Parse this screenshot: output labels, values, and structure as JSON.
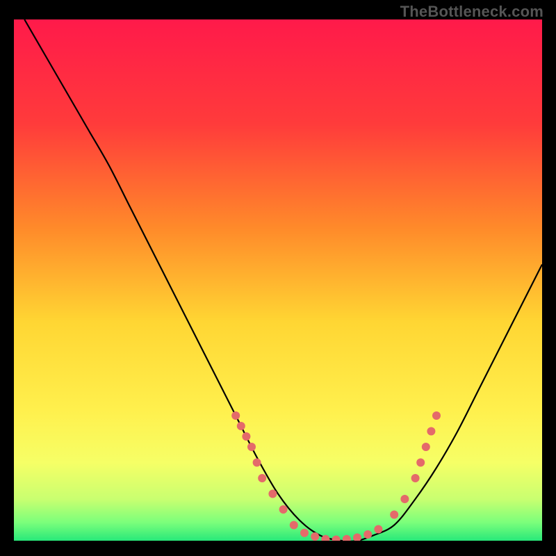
{
  "watermark": "TheBottleneck.com",
  "chart_data": {
    "type": "line",
    "title": "",
    "xlabel": "",
    "ylabel": "",
    "xlim": [
      0,
      100
    ],
    "ylim": [
      0,
      100
    ],
    "background_gradient": {
      "orientation": "vertical",
      "stops": [
        {
          "offset": 0.0,
          "color": "#ff1a4a"
        },
        {
          "offset": 0.2,
          "color": "#ff3b3b"
        },
        {
          "offset": 0.4,
          "color": "#ff8a2a"
        },
        {
          "offset": 0.58,
          "color": "#ffd633"
        },
        {
          "offset": 0.75,
          "color": "#fff04d"
        },
        {
          "offset": 0.85,
          "color": "#f6ff66"
        },
        {
          "offset": 0.92,
          "color": "#c9ff70"
        },
        {
          "offset": 0.965,
          "color": "#7bff7b"
        },
        {
          "offset": 1.0,
          "color": "#28e87a"
        }
      ]
    },
    "series": [
      {
        "name": "bottleneck-curve",
        "color": "#000000",
        "x": [
          2,
          6,
          10,
          14,
          18,
          22,
          26,
          30,
          34,
          38,
          42,
          46,
          50,
          54,
          58,
          62,
          65,
          68,
          72,
          76,
          80,
          84,
          88,
          92,
          96,
          100
        ],
        "y": [
          100,
          93,
          86,
          79,
          72,
          64,
          56,
          48,
          40,
          32,
          24,
          16,
          9,
          4,
          1,
          0,
          0,
          1,
          3,
          8,
          14,
          21,
          29,
          37,
          45,
          53
        ]
      }
    ],
    "markers": {
      "name": "bottleneck-dots",
      "color": "#e46a6a",
      "radius": 6,
      "points": [
        {
          "x": 42,
          "y": 24
        },
        {
          "x": 43,
          "y": 22
        },
        {
          "x": 44,
          "y": 20
        },
        {
          "x": 45,
          "y": 18
        },
        {
          "x": 46,
          "y": 15
        },
        {
          "x": 47,
          "y": 12
        },
        {
          "x": 49,
          "y": 9
        },
        {
          "x": 51,
          "y": 6
        },
        {
          "x": 53,
          "y": 3
        },
        {
          "x": 55,
          "y": 1.5
        },
        {
          "x": 57,
          "y": 0.8
        },
        {
          "x": 59,
          "y": 0.3
        },
        {
          "x": 61,
          "y": 0.2
        },
        {
          "x": 63,
          "y": 0.3
        },
        {
          "x": 65,
          "y": 0.6
        },
        {
          "x": 67,
          "y": 1.2
        },
        {
          "x": 69,
          "y": 2.2
        },
        {
          "x": 72,
          "y": 5
        },
        {
          "x": 74,
          "y": 8
        },
        {
          "x": 76,
          "y": 12
        },
        {
          "x": 77,
          "y": 15
        },
        {
          "x": 78,
          "y": 18
        },
        {
          "x": 79,
          "y": 21
        },
        {
          "x": 80,
          "y": 24
        }
      ]
    }
  }
}
